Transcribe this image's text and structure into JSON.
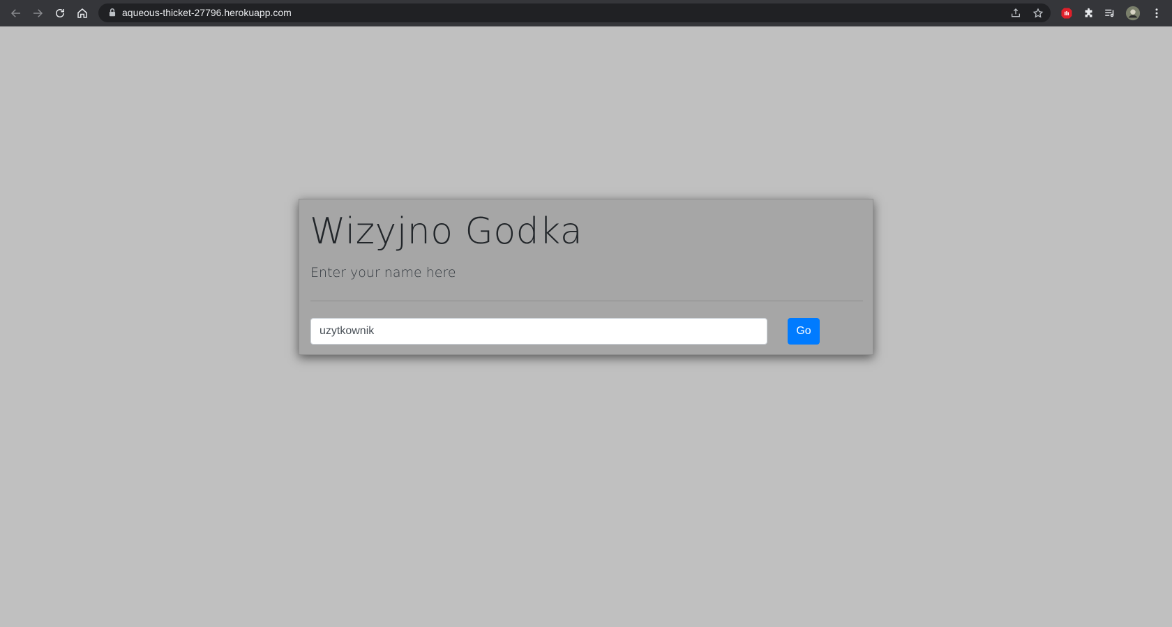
{
  "browser": {
    "url": "aqueous-thicket-27796.herokuapp.com",
    "icons": [
      "back-icon",
      "forward-icon",
      "reload-icon",
      "home-icon",
      "lock-icon",
      "share-icon",
      "bookmark-star-icon",
      "adblock-icon",
      "extensions-icon",
      "media-control-icon",
      "profile-avatar",
      "more-menu-icon"
    ]
  },
  "card": {
    "title": "Wizyjno Godka",
    "subtitle": "Enter your name here",
    "name_value": "uzytkownik",
    "go_label": "Go"
  },
  "colors": {
    "page_background": "#c0c0c0",
    "card_background": "#a6a6a6",
    "button_primary": "#007bff",
    "chrome_toolbar": "#35363a",
    "omnibox": "#202124"
  }
}
